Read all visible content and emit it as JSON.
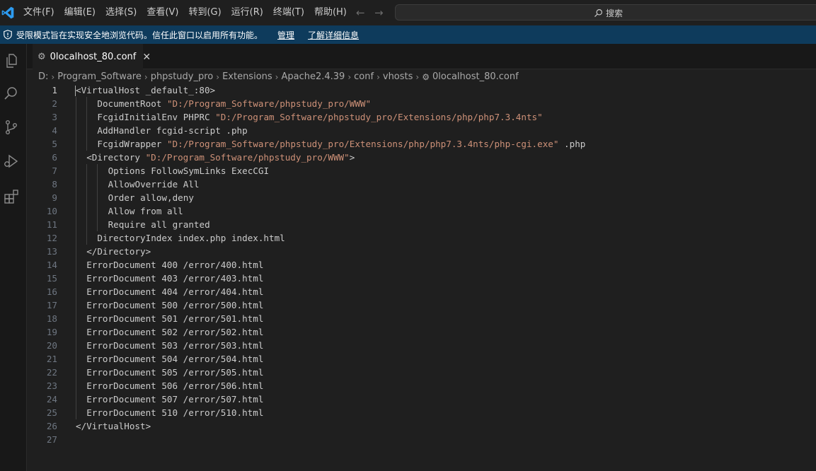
{
  "menu": [
    "文件(F)",
    "编辑(E)",
    "选择(S)",
    "查看(V)",
    "转到(G)",
    "运行(R)",
    "终端(T)",
    "帮助(H)"
  ],
  "search": {
    "label": "搜索"
  },
  "banner": {
    "text": "受限模式旨在实现安全地浏览代码。信任此窗口以启用所有功能。",
    "manage_link": "管理",
    "learn_more_link": "了解详细信息"
  },
  "tab": {
    "label": "0localhost_80.conf"
  },
  "breadcrumb": [
    "D:",
    "Program_Software",
    "phpstudy_pro",
    "Extensions",
    "Apache2.4.39",
    "conf",
    "vhosts",
    "0localhost_80.conf"
  ],
  "colors": {
    "accent": "#0078d4",
    "banner_bg": "#0e3b5c",
    "string": "#ce9178",
    "editor_bg": "#1f1f1f"
  },
  "editor": {
    "active_line": 1,
    "lines": [
      {
        "n": "1",
        "indent": 0,
        "parts": [
          {
            "t": "<VirtualHost _default_:80>"
          }
        ]
      },
      {
        "n": "2",
        "indent": 2,
        "parts": [
          {
            "t": "DocumentRoot "
          },
          {
            "t": "\"D:/Program_Software/phpstudy_pro/WWW\"",
            "s": true
          }
        ]
      },
      {
        "n": "3",
        "indent": 2,
        "parts": [
          {
            "t": "FcgidInitialEnv PHPRC "
          },
          {
            "t": "\"D:/Program_Software/phpstudy_pro/Extensions/php/php7.3.4nts\"",
            "s": true
          }
        ]
      },
      {
        "n": "4",
        "indent": 2,
        "parts": [
          {
            "t": "AddHandler fcgid-script .php"
          }
        ]
      },
      {
        "n": "5",
        "indent": 2,
        "parts": [
          {
            "t": "FcgidWrapper "
          },
          {
            "t": "\"D:/Program_Software/phpstudy_pro/Extensions/php/php7.3.4nts/php-cgi.exe\"",
            "s": true
          },
          {
            "t": " .php"
          }
        ]
      },
      {
        "n": "6",
        "indent": 1,
        "parts": [
          {
            "t": "<Directory "
          },
          {
            "t": "\"D:/Program_Software/phpstudy_pro/WWW\"",
            "s": true
          },
          {
            "t": ">"
          }
        ]
      },
      {
        "n": "7",
        "indent": 3,
        "parts": [
          {
            "t": "Options FollowSymLinks ExecCGI"
          }
        ]
      },
      {
        "n": "8",
        "indent": 3,
        "parts": [
          {
            "t": "AllowOverride All"
          }
        ]
      },
      {
        "n": "9",
        "indent": 3,
        "parts": [
          {
            "t": "Order allow,deny"
          }
        ]
      },
      {
        "n": "10",
        "indent": 3,
        "parts": [
          {
            "t": "Allow from all"
          }
        ]
      },
      {
        "n": "11",
        "indent": 3,
        "parts": [
          {
            "t": "Require all granted"
          }
        ]
      },
      {
        "n": "12",
        "indent": 2,
        "parts": [
          {
            "t": "DirectoryIndex index.php index.html"
          }
        ]
      },
      {
        "n": "13",
        "indent": 1,
        "parts": [
          {
            "t": "</Directory>"
          }
        ]
      },
      {
        "n": "14",
        "indent": 1,
        "parts": [
          {
            "t": "ErrorDocument 400 /error/400.html"
          }
        ]
      },
      {
        "n": "15",
        "indent": 1,
        "parts": [
          {
            "t": "ErrorDocument 403 /error/403.html"
          }
        ]
      },
      {
        "n": "16",
        "indent": 1,
        "parts": [
          {
            "t": "ErrorDocument 404 /error/404.html"
          }
        ]
      },
      {
        "n": "17",
        "indent": 1,
        "parts": [
          {
            "t": "ErrorDocument 500 /error/500.html"
          }
        ]
      },
      {
        "n": "18",
        "indent": 1,
        "parts": [
          {
            "t": "ErrorDocument 501 /error/501.html"
          }
        ]
      },
      {
        "n": "19",
        "indent": 1,
        "parts": [
          {
            "t": "ErrorDocument 502 /error/502.html"
          }
        ]
      },
      {
        "n": "20",
        "indent": 1,
        "parts": [
          {
            "t": "ErrorDocument 503 /error/503.html"
          }
        ]
      },
      {
        "n": "21",
        "indent": 1,
        "parts": [
          {
            "t": "ErrorDocument 504 /error/504.html"
          }
        ]
      },
      {
        "n": "22",
        "indent": 1,
        "parts": [
          {
            "t": "ErrorDocument 505 /error/505.html"
          }
        ]
      },
      {
        "n": "23",
        "indent": 1,
        "parts": [
          {
            "t": "ErrorDocument 506 /error/506.html"
          }
        ]
      },
      {
        "n": "24",
        "indent": 1,
        "parts": [
          {
            "t": "ErrorDocument 507 /error/507.html"
          }
        ]
      },
      {
        "n": "25",
        "indent": 1,
        "parts": [
          {
            "t": "ErrorDocument 510 /error/510.html"
          }
        ]
      },
      {
        "n": "26",
        "indent": 0,
        "parts": [
          {
            "t": "</VirtualHost>"
          }
        ]
      },
      {
        "n": "27",
        "indent": 0,
        "parts": []
      }
    ]
  }
}
